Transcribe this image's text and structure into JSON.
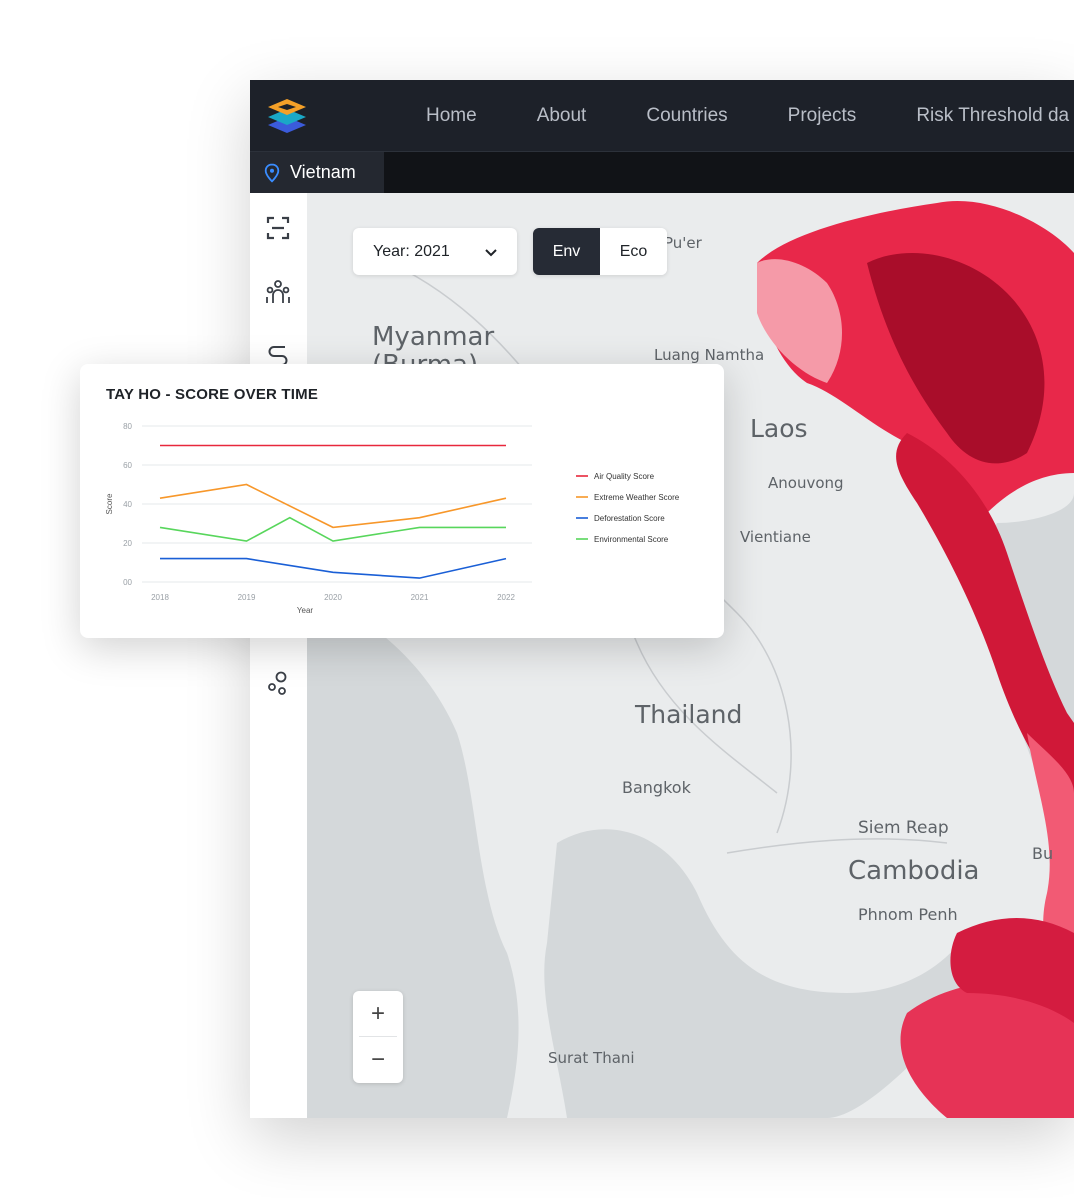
{
  "nav": {
    "items": [
      "Home",
      "About",
      "Countries",
      "Projects",
      "Risk Threshold da"
    ]
  },
  "country_tab": {
    "label": "Vietnam"
  },
  "controls": {
    "year_select": "Year: 2021",
    "toggle": {
      "env": "Env",
      "eco": "Eco",
      "selected": "Env"
    }
  },
  "zoom": {
    "in": "+",
    "out": "−"
  },
  "map_labels": {
    "myanmar": "Myanmar",
    "myanmar_sub": "(Burma)",
    "puer": "Pu'er",
    "luang_namtha": "Luang Namtha",
    "laos": "Laos",
    "anouvong": "Anouvong",
    "vientiane": "Vientiane",
    "thailand": "Thailand",
    "bangkok": "Bangkok",
    "siem_reap": "Siem Reap",
    "cambodia": "Cambodia",
    "phnom_penh": "Phnom Penh",
    "surat_thani": "Surat Thani",
    "bu": "Bu"
  },
  "colors": {
    "nav_bg": "#1d2129",
    "map_bg": "#e9ebec",
    "choropleth": "#e0153a"
  },
  "chart_data": {
    "type": "line",
    "title": "TAY HO - SCORE OVER TIME",
    "xlabel": "Year",
    "ylabel": "Score",
    "x": [
      "2018",
      "2019",
      "2020",
      "2021",
      "2022"
    ],
    "ylim": [
      0,
      80
    ],
    "yticks": [
      "00",
      "20",
      "40",
      "60",
      "80"
    ],
    "grid": true,
    "legend_position": "right",
    "series": [
      {
        "name": "Air Quality Score",
        "color": "#e8283c",
        "points": [
          [
            2018,
            70
          ],
          [
            2022,
            70
          ]
        ]
      },
      {
        "name": "Extreme Weather Score",
        "color": "#f7972a",
        "points": [
          [
            2018,
            43
          ],
          [
            2019,
            50
          ],
          [
            2020,
            28
          ],
          [
            2021,
            33
          ],
          [
            2022,
            43
          ]
        ]
      },
      {
        "name": "Deforestation Score",
        "color": "#1a5fd6",
        "points": [
          [
            2018,
            12
          ],
          [
            2019,
            12
          ],
          [
            2020,
            5
          ],
          [
            2021,
            2
          ],
          [
            2022,
            12
          ]
        ]
      },
      {
        "name": "Environmental Score",
        "color": "#58d65c",
        "points": [
          [
            2018,
            28
          ],
          [
            2019,
            21
          ],
          [
            2019.5,
            33
          ],
          [
            2020,
            21
          ],
          [
            2021,
            28
          ],
          [
            2022,
            28
          ]
        ]
      }
    ]
  }
}
